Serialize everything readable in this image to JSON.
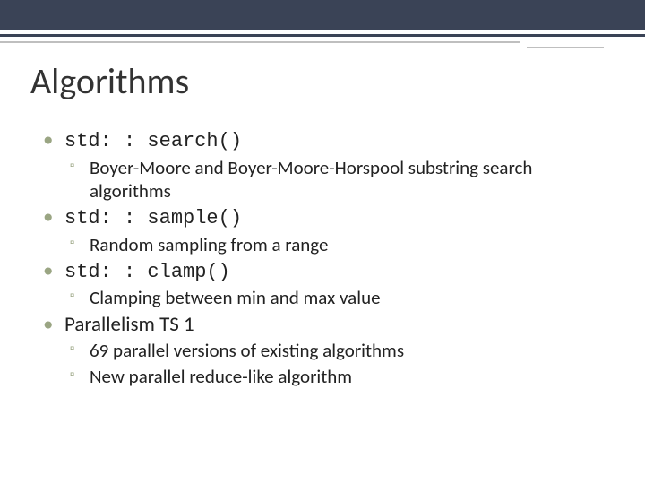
{
  "title": "Algorithms",
  "items": [
    {
      "label": "std: : search()",
      "mono": true,
      "sub": [
        "Boyer-Moore and Boyer-Moore-Horspool substring search algorithms"
      ]
    },
    {
      "label": "std: : sample()",
      "mono": true,
      "sub": [
        "Random sampling from a range"
      ]
    },
    {
      "label": "std: : clamp()",
      "mono": true,
      "sub": [
        "Clamping between min and max value"
      ]
    },
    {
      "label": "Parallelism TS 1",
      "mono": false,
      "sub": [
        "69 parallel versions of existing algorithms",
        "New parallel reduce-like algorithm"
      ]
    }
  ]
}
